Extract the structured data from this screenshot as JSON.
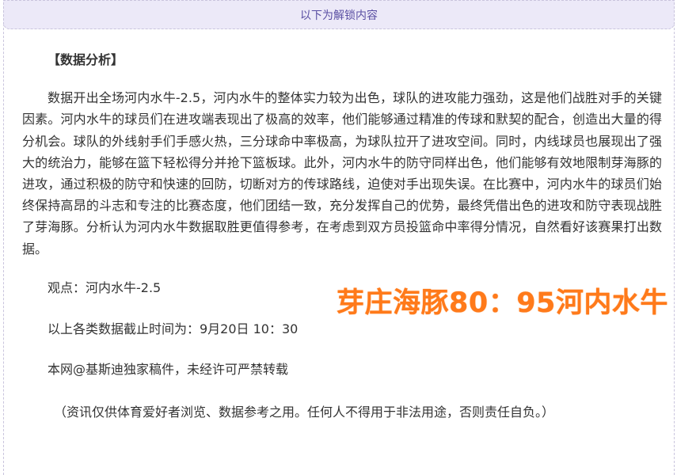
{
  "unlock_bar": {
    "label": "以下为解锁内容"
  },
  "article": {
    "heading": "【数据分析】",
    "body": "数据开出全场河内水牛-2.5，河内水牛的整体实力较为出色，球队的进攻能力强劲，这是他们战胜对手的关键因素。河内水牛的球员们在进攻端表现出了极高的效率，他们能够通过精准的传球和默契的配合，创造出大量的得分机会。球队的外线射手们手感火热，三分球命中率极高，为球队拉开了进攻空间。同时，内线球员也展现出了强大的统治力，能够在篮下轻松得分并抢下篮板球。此外，河内水牛的防守同样出色，他们能够有效地限制芽海豚的进攻，通过积极的防守和快速的回防，切断对方的传球路线，迫使对手出现失误。在比赛中，河内水牛的球员们始终保持高昂的斗志和专注的比赛态度，他们团结一致，充分发挥自己的优势，最终凭借出色的进攻和防守表现战胜了芽海豚。分析认为河内水牛数据取胜更值得参考，在考虑到双方员投篮命中率得分情况，自然看好该赛果打出数据。",
    "viewpoint": "观点：河内水牛-2.5",
    "cutoff": "以上各类数据截止时间为：9月20日 10：30",
    "copyright": "本网@基斯迪独家稿件，未经许可严禁转载",
    "disclaimer": "（资讯仅供体育爱好者浏览、数据参考之用。任何人不得用于非法用途，否则责任自负。）"
  },
  "overlay": {
    "score_text": "芽庄海豚80：95河内水牛",
    "color": "#ff7a1a"
  }
}
